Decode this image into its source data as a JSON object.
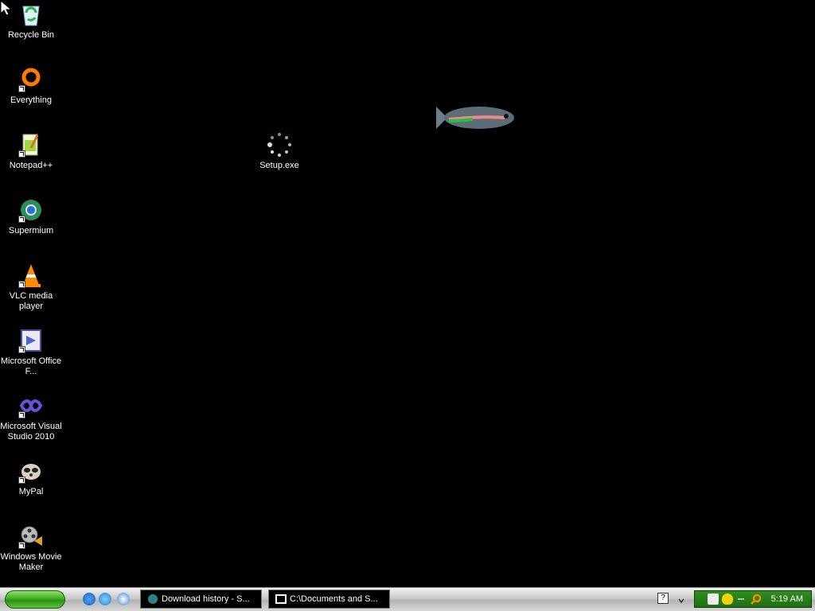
{
  "desktop": {
    "icons": [
      {
        "label": "Recycle Bin",
        "icon": "recycle-bin-icon"
      },
      {
        "label": "Everything",
        "icon": "everything-icon"
      },
      {
        "label": "Notepad++",
        "icon": "notepadpp-icon"
      },
      {
        "label": "Supermium",
        "icon": "supermium-icon"
      },
      {
        "label": "VLC media player",
        "icon": "vlc-icon"
      },
      {
        "label": "Microsoft Office F...",
        "icon": "office-icon"
      },
      {
        "label": "Microsoft Visual Studio 2010",
        "icon": "visual-studio-icon"
      },
      {
        "label": "MyPal",
        "icon": "mypal-icon"
      },
      {
        "label": "Windows Movie Maker",
        "icon": "movie-maker-icon"
      }
    ],
    "setup_icon": {
      "label": "Setup.exe",
      "icon": "loading-icon"
    },
    "fish_icon": "fish-icon"
  },
  "taskbar": {
    "quicklaunch": [
      "ie-icon",
      "ie-alt-icon",
      "media-player-icon"
    ],
    "tasks": [
      {
        "label": "Download history - S...",
        "icon": "browser-icon"
      },
      {
        "label": "C:\\Documents and S...",
        "icon": "7zip-icon"
      }
    ],
    "tray": {
      "time": "5:19 AM"
    }
  },
  "colors": {
    "desktop": "#000000",
    "taskbar": "#d0d0d0",
    "tray": "#2f8f1f",
    "start": "#3fae21"
  }
}
